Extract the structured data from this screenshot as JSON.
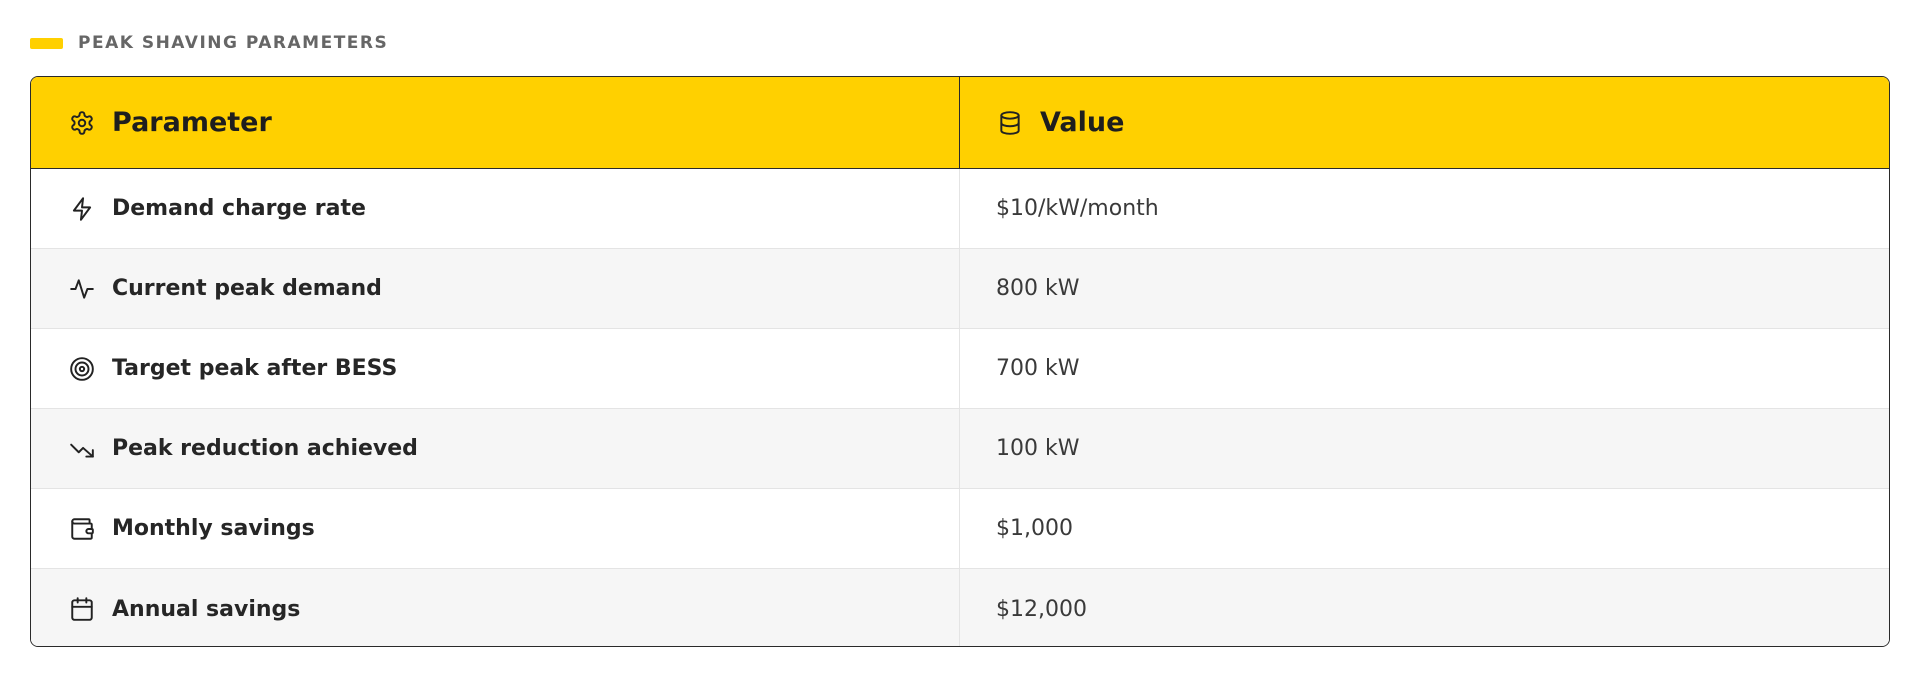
{
  "section": {
    "title": "PEAK SHAVING PARAMETERS",
    "accent_color": "#FFD000"
  },
  "table": {
    "header": {
      "parameter_label": "Parameter",
      "parameter_icon": "gear-icon",
      "value_label": "Value",
      "value_icon": "database-icon",
      "background": "#FFD000"
    },
    "rows": [
      {
        "icon": "lightning-icon",
        "parameter": "Demand charge rate",
        "value": "$10/kW/month"
      },
      {
        "icon": "activity-pulse-icon",
        "parameter": "Current peak demand",
        "value": "800 kW"
      },
      {
        "icon": "target-icon",
        "parameter": "Target peak after BESS",
        "value": "700 kW"
      },
      {
        "icon": "trending-down-icon",
        "parameter": "Peak reduction achieved",
        "value": "100 kW"
      },
      {
        "icon": "wallet-icon",
        "parameter": "Monthly savings",
        "value": "$1,000"
      },
      {
        "icon": "calendar-icon",
        "parameter": "Annual savings",
        "value": "$12,000"
      }
    ]
  }
}
